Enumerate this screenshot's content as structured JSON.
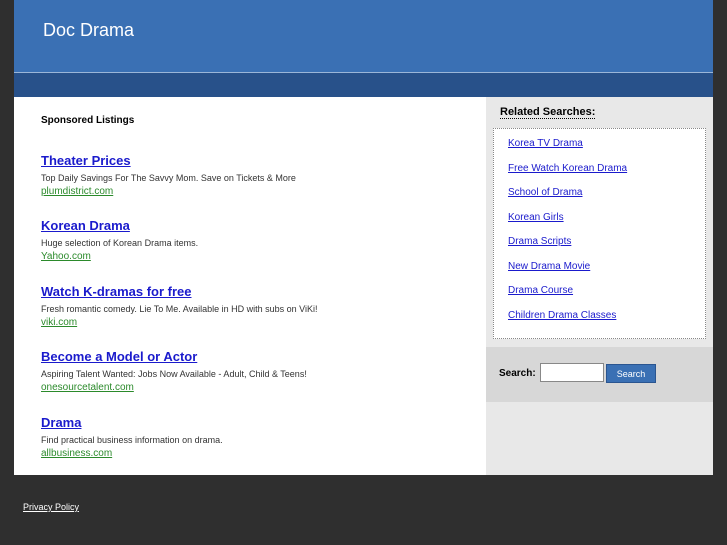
{
  "header": {
    "title": "Doc Drama"
  },
  "main": {
    "sponsored_heading": "Sponsored Listings",
    "listings": [
      {
        "title": "Theater Prices",
        "description": "Top Daily Savings For The Savvy Mom. Save on Tickets & More",
        "url": "plumdistrict.com"
      },
      {
        "title": "Korean Drama",
        "description": "Huge selection of Korean Drama items.",
        "url": "Yahoo.com"
      },
      {
        "title": "Watch K-dramas for free",
        "description": "Fresh romantic comedy. Lie To Me. Available in HD with subs on ViKi!",
        "url": "viki.com"
      },
      {
        "title": "Become a Model or Actor",
        "description": "Aspiring Talent Wanted: Jobs Now Available - Adult, Child & Teens!",
        "url": "onesourcetalent.com"
      },
      {
        "title": "Drama",
        "description": "Find practical business information on drama.",
        "url": "allbusiness.com"
      }
    ]
  },
  "sidebar": {
    "related_heading": "Related Searches:",
    "related": [
      "Korea TV Drama",
      "Free Watch Korean Drama",
      "School of Drama",
      "Korean Girls",
      "Drama Scripts",
      "New Drama Movie",
      "Drama Course",
      "Children Drama Classes"
    ],
    "search": {
      "label": "Search:",
      "value": "",
      "button_label": "Search"
    }
  },
  "footer": {
    "privacy_label": "Privacy Policy"
  }
}
